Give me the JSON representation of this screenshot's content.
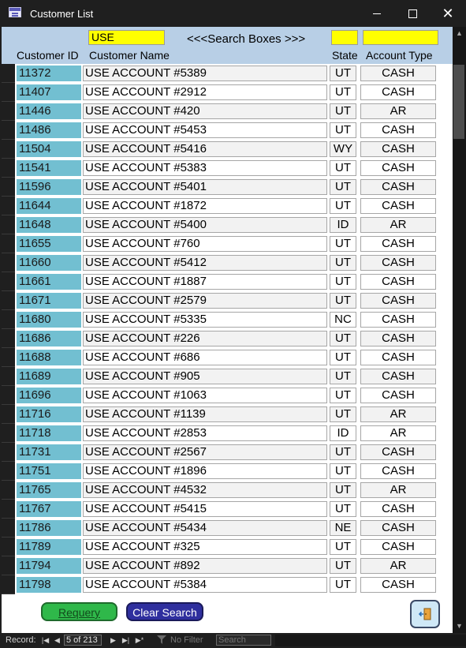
{
  "window": {
    "title": "Customer List"
  },
  "search": {
    "name_value": "USE",
    "state_value": "",
    "type_value": "",
    "note": "<<<Search Boxes >>>"
  },
  "columns": {
    "id": "Customer ID",
    "name": "Customer Name",
    "state": "State",
    "type": "Account Type"
  },
  "rows": [
    {
      "id": "11372",
      "name": "USE ACCOUNT #5389",
      "state": "UT",
      "type": "CASH"
    },
    {
      "id": "11407",
      "name": "USE ACCOUNT #2912",
      "state": "UT",
      "type": "CASH"
    },
    {
      "id": "11446",
      "name": "USE ACCOUNT #420",
      "state": "UT",
      "type": "AR"
    },
    {
      "id": "11486",
      "name": "USE ACCOUNT #5453",
      "state": "UT",
      "type": "CASH"
    },
    {
      "id": "11504",
      "name": "USE ACCOUNT #5416",
      "state": "WY",
      "type": "CASH"
    },
    {
      "id": "11541",
      "name": "USE ACCOUNT #5383",
      "state": "UT",
      "type": "CASH"
    },
    {
      "id": "11596",
      "name": "USE ACCOUNT #5401",
      "state": "UT",
      "type": "CASH"
    },
    {
      "id": "11644",
      "name": "USE ACCOUNT #1872",
      "state": "UT",
      "type": "CASH"
    },
    {
      "id": "11648",
      "name": "USE ACCOUNT #5400",
      "state": "ID",
      "type": "AR"
    },
    {
      "id": "11655",
      "name": "USE ACCOUNT #760",
      "state": "UT",
      "type": "CASH"
    },
    {
      "id": "11660",
      "name": "USE ACCOUNT #5412",
      "state": "UT",
      "type": "CASH"
    },
    {
      "id": "11661",
      "name": "USE ACCOUNT #1887",
      "state": "UT",
      "type": "CASH"
    },
    {
      "id": "11671",
      "name": "USE ACCOUNT #2579",
      "state": "UT",
      "type": "CASH"
    },
    {
      "id": "11680",
      "name": "USE ACCOUNT #5335",
      "state": "NC",
      "type": "CASH"
    },
    {
      "id": "11686",
      "name": "USE ACCOUNT #226",
      "state": "UT",
      "type": "CASH"
    },
    {
      "id": "11688",
      "name": "USE ACCOUNT #686",
      "state": "UT",
      "type": "CASH"
    },
    {
      "id": "11689",
      "name": "USE ACCOUNT #905",
      "state": "UT",
      "type": "CASH"
    },
    {
      "id": "11696",
      "name": "USE ACCOUNT #1063",
      "state": "UT",
      "type": "CASH"
    },
    {
      "id": "11716",
      "name": "USE ACCOUNT #1139",
      "state": "UT",
      "type": "AR"
    },
    {
      "id": "11718",
      "name": "USE ACCOUNT #2853",
      "state": "ID",
      "type": "AR"
    },
    {
      "id": "11731",
      "name": "USE ACCOUNT #2567",
      "state": "UT",
      "type": "CASH"
    },
    {
      "id": "11751",
      "name": "USE ACCOUNT #1896",
      "state": "UT",
      "type": "CASH"
    },
    {
      "id": "11765",
      "name": "USE ACCOUNT #4532",
      "state": "UT",
      "type": "AR"
    },
    {
      "id": "11767",
      "name": "USE ACCOUNT #5415",
      "state": "UT",
      "type": "CASH"
    },
    {
      "id": "11786",
      "name": "USE ACCOUNT #5434",
      "state": "NE",
      "type": "CASH"
    },
    {
      "id": "11789",
      "name": "USE ACCOUNT #325",
      "state": "UT",
      "type": "CASH"
    },
    {
      "id": "11794",
      "name": "USE ACCOUNT #892",
      "state": "UT",
      "type": "AR"
    },
    {
      "id": "11798",
      "name": "USE ACCOUNT #5384",
      "state": "UT",
      "type": "CASH"
    }
  ],
  "buttons": {
    "requery": "Requery",
    "clear_search": "Clear Search",
    "exit_icon": "exit-door-icon"
  },
  "navigation": {
    "record_label": "Record:",
    "record_value": "5 of 213",
    "filter_label": "No Filter",
    "search_placeholder": "Search"
  },
  "colors": {
    "header_bg": "#b8cfe6",
    "search_box": "#ffff00",
    "id_cell": "#72bfd1",
    "requery_button": "#2fb84a",
    "clear_button": "#2f2f9e"
  }
}
